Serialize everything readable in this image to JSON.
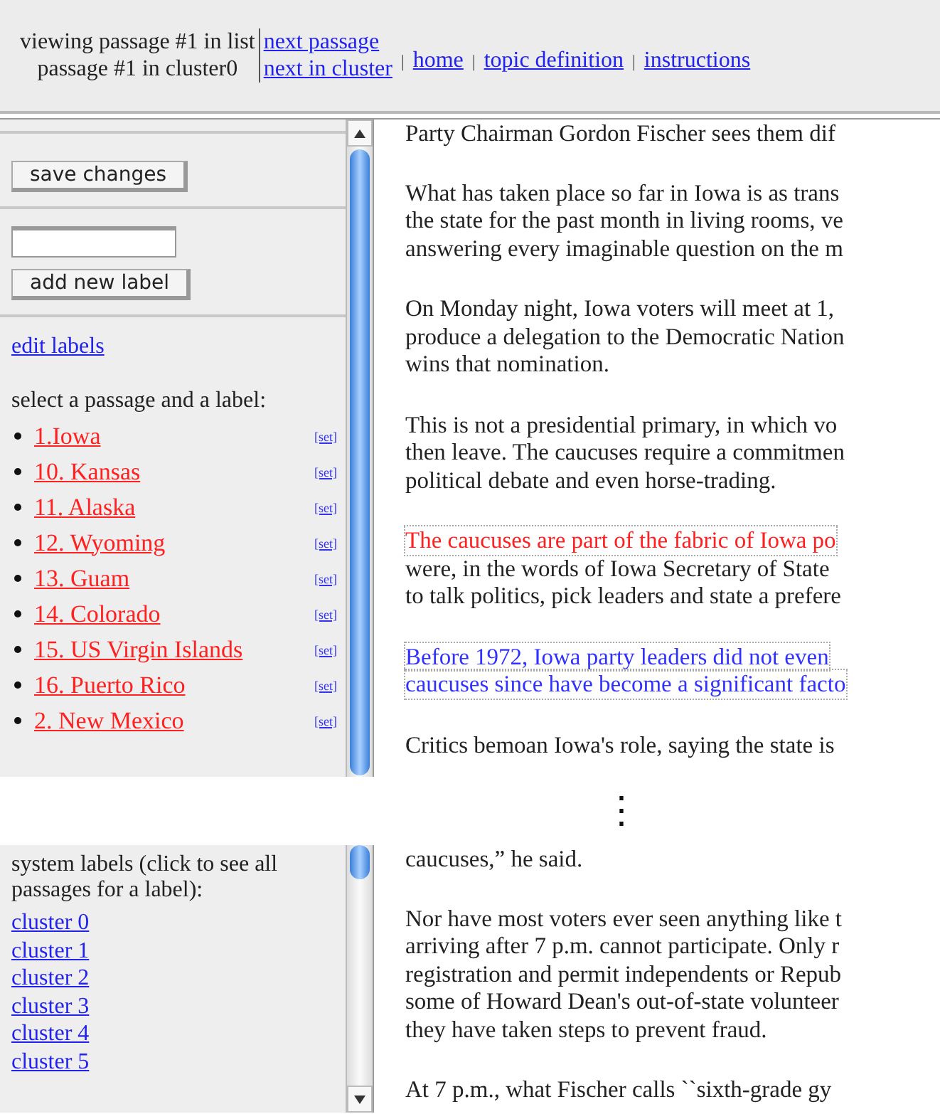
{
  "header": {
    "status_lines": [
      "viewing passage #1 in list",
      "passage #1 in cluster0"
    ],
    "nav_links": [
      {
        "label": "next passage"
      },
      {
        "label": "next in cluster"
      }
    ],
    "menu": [
      {
        "separator": "|",
        "label": "home"
      },
      {
        "separator": "|",
        "label": "topic definition"
      },
      {
        "separator": "|",
        "label": "instructions"
      }
    ]
  },
  "upper_panel": {
    "sidebar": {
      "save_button": "save changes",
      "add_button": "add new label",
      "edit_link": "edit labels",
      "prompt": "select a passage and a label:",
      "passages": [
        {
          "label": "1.Iowa",
          "set_link": "[set]"
        },
        {
          "label": "10. Kansas",
          "set_link": "[set]"
        },
        {
          "label": "11. Alaska",
          "set_link": "[set]"
        },
        {
          "label": "12. Wyoming",
          "set_link": "[set]"
        },
        {
          "label": "13. Guam",
          "set_link": "[set]"
        },
        {
          "label": "14. Colorado",
          "set_link": "[set]"
        },
        {
          "label": "15. US Virgin Islands",
          "set_link": "[set]"
        },
        {
          "label": "16. Puerto Rico",
          "set_link": "[set]"
        },
        {
          "label": "2. New Mexico",
          "set_link": "[set]"
        }
      ]
    },
    "passage": {
      "paragraphs": [
        {
          "lines": [
            {
              "text": "Party Chairman Gordon Fischer sees them dif"
            }
          ]
        },
        {
          "lines": [
            {
              "text": "What has taken place so far in Iowa is as trans"
            },
            {
              "text": "the state for the past month in living rooms, ve"
            },
            {
              "text": "answering every imaginable question on the m"
            }
          ]
        },
        {
          "lines": [
            {
              "text": "On Monday night, Iowa voters will meet at 1,"
            },
            {
              "text": "produce a delegation to the Democratic Nation"
            },
            {
              "text": "wins that nomination."
            }
          ]
        },
        {
          "lines": [
            {
              "text": "This is not a presidential primary, in which vo"
            },
            {
              "text": "then leave. The caucuses require a commitmen"
            },
            {
              "text": "political debate and even horse-trading."
            }
          ]
        },
        {
          "lines": [
            {
              "text": "The caucuses are part of the fabric of Iowa po",
              "color": "#ff2020"
            },
            {
              "text": "were, in the words of Iowa Secretary of State"
            },
            {
              "text": "to talk politics, pick leaders and state a prefere"
            }
          ]
        },
        {
          "lines": [
            {
              "text": "Before 1972, Iowa party leaders did not even",
              "color": "#3030ff"
            },
            {
              "text": "caucuses since have become a significant facto",
              "color": "#3030ff"
            }
          ]
        },
        {
          "lines": [
            {
              "text": "Critics bemoan Iowa's role, saying the state is"
            }
          ]
        }
      ]
    }
  },
  "gap_mark": "⋮",
  "lower_panel": {
    "sidebar": {
      "intro": "system labels (click to see all passages for a label):",
      "clusters": [
        "cluster 0",
        "cluster 1",
        "cluster 2",
        "cluster 3",
        "cluster 4",
        "cluster 5"
      ]
    },
    "passage": {
      "paragraphs": [
        {
          "lines": [
            {
              "text": "caucuses,” he said."
            }
          ]
        },
        {
          "lines": [
            {
              "text": "Nor have most voters ever seen anything like t"
            },
            {
              "text": "arriving after 7 p.m. cannot participate. Only r"
            },
            {
              "text": "registration and permit independents or Repub"
            },
            {
              "text": "some of Howard Dean's out-of-state volunteer"
            },
            {
              "text": "they have taken steps to prevent fraud."
            }
          ]
        },
        {
          "lines": [
            {
              "text": "At 7 p.m., what Fischer calls ``sixth-grade gy"
            }
          ]
        }
      ]
    }
  }
}
